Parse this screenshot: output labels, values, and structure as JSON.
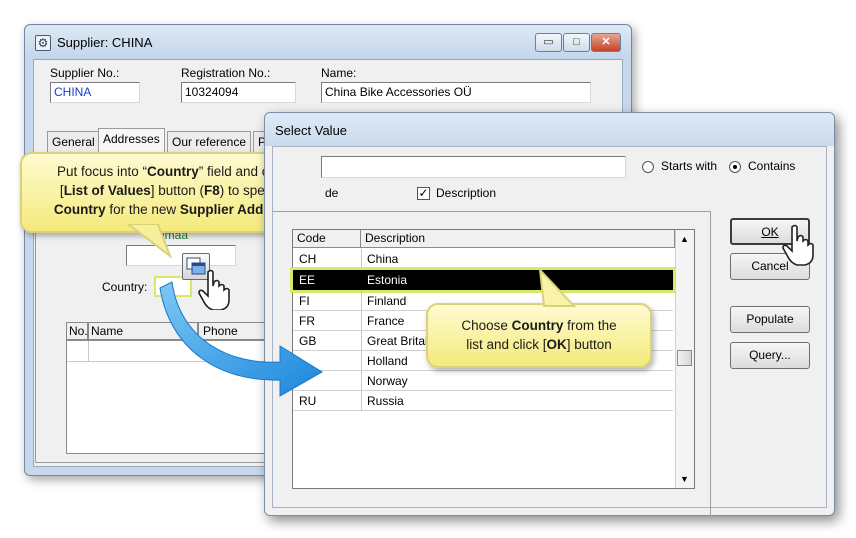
{
  "supplier_window": {
    "title": "Supplier: CHINA",
    "min_symbol": "▭",
    "max_symbol": "□",
    "close_symbol": "✕",
    "supplier_no_label": "Supplier No.:",
    "supplier_no_value": "CHINA",
    "registration_no_label": "Registration No.:",
    "registration_no_value": "10324094",
    "name_label": "Name:",
    "name_value": "China Bike Accessories OÜ",
    "tabs": [
      {
        "label": "General"
      },
      {
        "label": "Addresses"
      },
      {
        "label": "Our reference"
      },
      {
        "label": "P"
      }
    ],
    "partial_text": "rumaa",
    "country_label": "Country:",
    "grid_headers": {
      "no": "No.",
      "name": "Name",
      "phone": "Phone"
    }
  },
  "select_dialog": {
    "title": "Select Value",
    "starts_with_label": "Starts with",
    "contains_label": "Contains",
    "search_mode_selected": "Contains",
    "code_check_label": "de",
    "description_check_label": "Description",
    "description_checked": true,
    "columns": {
      "code": "Code",
      "description": "Description"
    },
    "rows": [
      {
        "code": "CH",
        "description": "China"
      },
      {
        "code": "EE",
        "description": "Estonia"
      },
      {
        "code": "FI",
        "description": "Finland"
      },
      {
        "code": "FR",
        "description": "France"
      },
      {
        "code": "GB",
        "description": "Great Britain"
      },
      {
        "code": "",
        "description": "Holland"
      },
      {
        "code": "",
        "description": "Norway"
      },
      {
        "code": "RU",
        "description": "Russia"
      }
    ],
    "selected_code": "EE",
    "buttons": {
      "ok": "OK",
      "cancel": "Cancel",
      "populate": "Populate",
      "query": "Query..."
    }
  },
  "callouts": {
    "focus": {
      "l1a": "Put focus into “",
      "l1b": "Country",
      "l1c": "” field and click",
      "l2a": "[",
      "l2b": "List of Values",
      "l2c": "] button (",
      "l2d": "F8",
      "l2e": ") to specify",
      "l3a": "Country",
      "l3b": " for the new ",
      "l3c": "Supplier Address"
    },
    "choose": {
      "l1a": "Choose ",
      "l1b": "Country",
      "l1c": " from the",
      "l2a": "list and click [",
      "l2b": "OK",
      "l2c": "] button"
    }
  },
  "colors": {
    "arrow": "#3aa3e8",
    "callout": "#f7ef9a",
    "highlight": "#d8e86a"
  }
}
